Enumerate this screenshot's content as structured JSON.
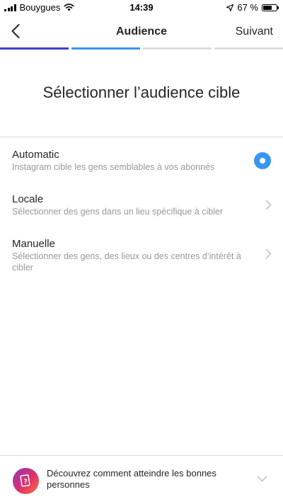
{
  "status_bar": {
    "carrier": "Bouygues",
    "time": "14:39",
    "battery_text": "67 %",
    "battery_level": 0.67,
    "signal_icon": "signal-bars-icon",
    "wifi_icon": "wifi-icon",
    "location_icon": "location-arrow-icon",
    "battery_icon": "battery-icon"
  },
  "nav": {
    "back_icon": "chevron-left-icon",
    "title": "Audience",
    "next_label": "Suivant"
  },
  "progress": {
    "steps_total": 4,
    "steps_done": 2,
    "active_colors": [
      "#3f3fd7",
      "#3797ef"
    ],
    "inactive_color": "#dbdbdb"
  },
  "heading": "Sélectionner l’audience cible",
  "options": [
    {
      "title": "Automatic",
      "description": "Instagram cible les gens semblables à vos abonnés",
      "control": "radio-selected"
    },
    {
      "title": "Locale",
      "description": "Sélectionner des gens dans un lieu spécifique à cibler",
      "control": "chevron-right-icon"
    },
    {
      "title": "Manuelle",
      "description": "Sélectionner des gens, des lieux ou des centres d’intérêt à cibler",
      "control": "chevron-right-icon"
    }
  ],
  "banner": {
    "icon": "promo-help-icon",
    "text": "Découvrez comment atteindre les bonnes personnes",
    "expand_icon": "chevron-down-icon"
  },
  "colors": {
    "accent": "#3797ef",
    "text": "#262626",
    "secondary_text": "#999999",
    "divider": "#dbdbdb",
    "chevron": "#c7c7cc"
  }
}
